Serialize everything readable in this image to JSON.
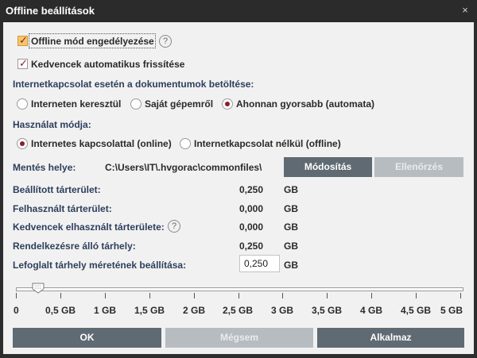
{
  "window": {
    "title": "Offline beállítások",
    "close_glyph": "×"
  },
  "options": {
    "offline_mode_label": "Offline mód engedélyezése",
    "offline_mode_checked": true,
    "favorites_refresh_label": "Kedvencek automatikus frissítése",
    "favorites_refresh_checked": true
  },
  "loading": {
    "heading": "Internetkapcsolat esetén a dokumentumok betöltése:",
    "options": [
      {
        "label": "Interneten keresztül",
        "selected": false
      },
      {
        "label": "Saját gépemről",
        "selected": false
      },
      {
        "label": "Ahonnan gyorsabb (automata)",
        "selected": true
      }
    ]
  },
  "usage": {
    "heading": "Használat módja:",
    "options": [
      {
        "label": "Internetes kapcsolattal (online)",
        "selected": true
      },
      {
        "label": "Internetkapcsolat nélkül (offline)",
        "selected": false
      }
    ]
  },
  "save_location": {
    "label": "Mentés helye:",
    "path": "C:\\Users\\IT\\.hvgorac\\commonfiles\\",
    "modify_button": "Módosítás",
    "check_button": "Ellenőrzés"
  },
  "storage": {
    "rows": [
      {
        "label": "Beállított tárterület:",
        "value": "0,250",
        "unit": "GB"
      },
      {
        "label": "Felhasznált tárterület:",
        "value": "0,000",
        "unit": "GB"
      },
      {
        "label": "Kedvencek elhasznált tárterülete:",
        "value": "0,000",
        "unit": "GB"
      },
      {
        "label": "Rendelkezésre álló tárhely:",
        "value": "0,250",
        "unit": "GB"
      }
    ],
    "reserve_label": "Lefoglalt tárhely méretének beállítása:",
    "reserve_value": "0,250",
    "reserve_unit": "GB"
  },
  "slider": {
    "min": 0,
    "max": 5,
    "value": 0.25,
    "ticks": [
      "0",
      "0,5 GB",
      "1 GB",
      "1,5 GB",
      "2 GB",
      "2,5 GB",
      "3 GB",
      "3,5 GB",
      "4 GB",
      "4,5 GB",
      "5 GB"
    ]
  },
  "footer": {
    "ok_button": "OK",
    "cancel_button": "Mégsem",
    "apply_button": "Alkalmaz"
  },
  "colors": {
    "titlebar": "#2b2b2b",
    "panel": "#f1f1f1",
    "accent_button": "#606a72",
    "radio_selected": "#8a1f2a",
    "checkbox_highlight": "#f6c66a"
  }
}
